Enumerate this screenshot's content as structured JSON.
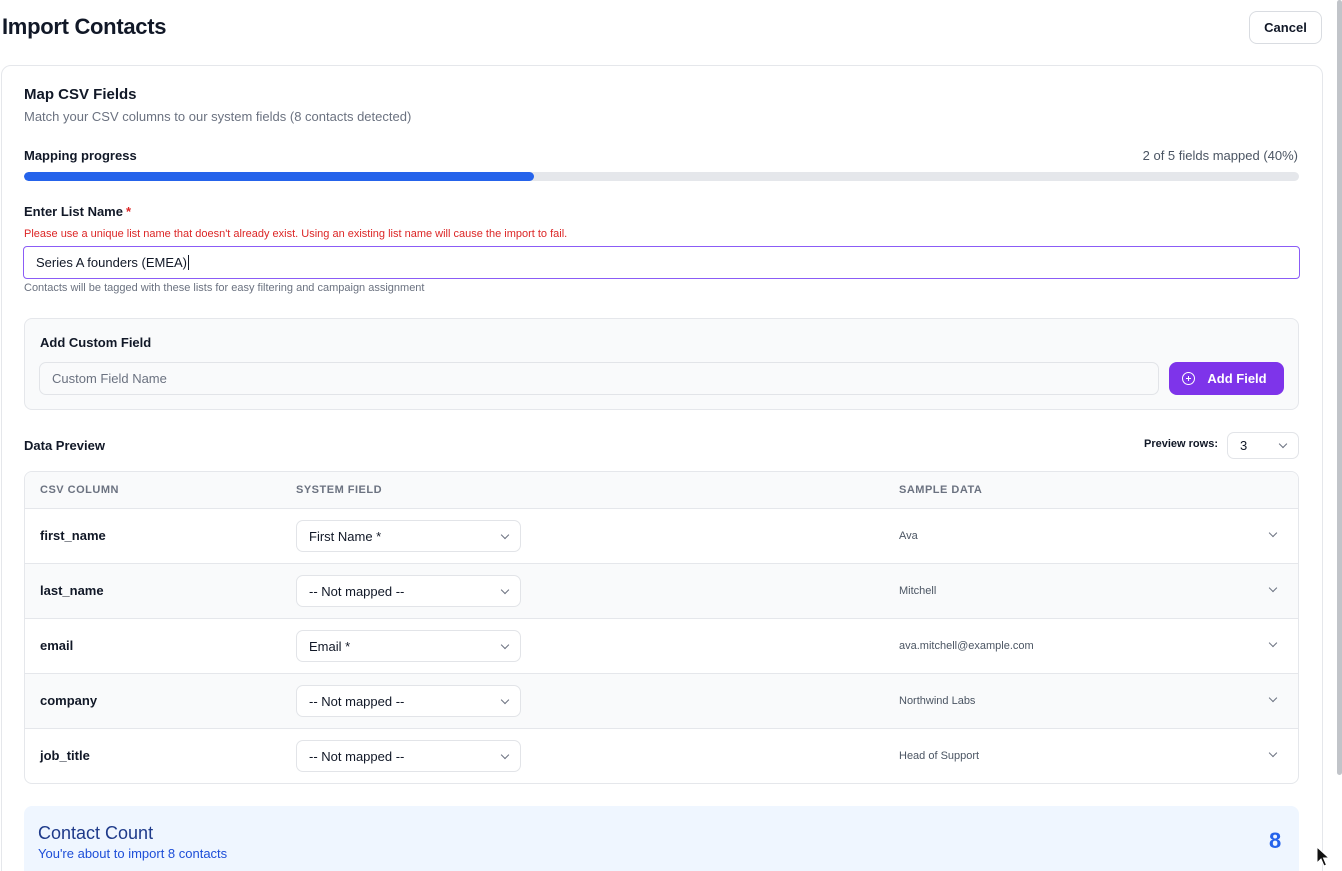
{
  "header": {
    "title": "Import Contacts",
    "cancel_label": "Cancel"
  },
  "mapping": {
    "title": "Map CSV Fields",
    "subtitle": "Match your CSV columns to our system fields (8 contacts detected)",
    "progress_label": "Mapping progress",
    "progress_status": "2 of 5 fields mapped (40%)",
    "progress_fraction": 0.4,
    "progress_color": "#2563eb"
  },
  "list_name": {
    "label": "Enter List Name",
    "required_mark": "*",
    "warning": "Please use a unique list name that doesn't already exist. Using an existing list name will cause the import to fail.",
    "value": "Series A founders (EMEA)",
    "help": "Contacts will be tagged with these lists for easy filtering and campaign assignment"
  },
  "custom_field": {
    "title": "Add Custom Field",
    "placeholder": "Custom Field Name",
    "button_label": "Add Field",
    "button_icon": "plus-circle-icon",
    "accent_color": "#7e34ea"
  },
  "preview": {
    "title": "Data Preview",
    "rows_label": "Preview rows:",
    "rows_value": "3"
  },
  "table": {
    "headers": {
      "csv": "CSV COLUMN",
      "system": "SYSTEM FIELD",
      "sample": "SAMPLE DATA"
    },
    "rows": [
      {
        "csv": "first_name",
        "system": "First Name *",
        "sample": "Ava"
      },
      {
        "csv": "last_name",
        "system": "-- Not mapped --",
        "sample": "Mitchell"
      },
      {
        "csv": "email",
        "system": "Email *",
        "sample": "ava.mitchell@example.com"
      },
      {
        "csv": "company",
        "system": "-- Not mapped --",
        "sample": "Northwind Labs"
      },
      {
        "csv": "job_title",
        "system": "-- Not mapped --",
        "sample": "Head of Support"
      }
    ]
  },
  "summary": {
    "title": "Contact Count",
    "subtitle": "You're about to import 8 contacts",
    "count": "8"
  }
}
